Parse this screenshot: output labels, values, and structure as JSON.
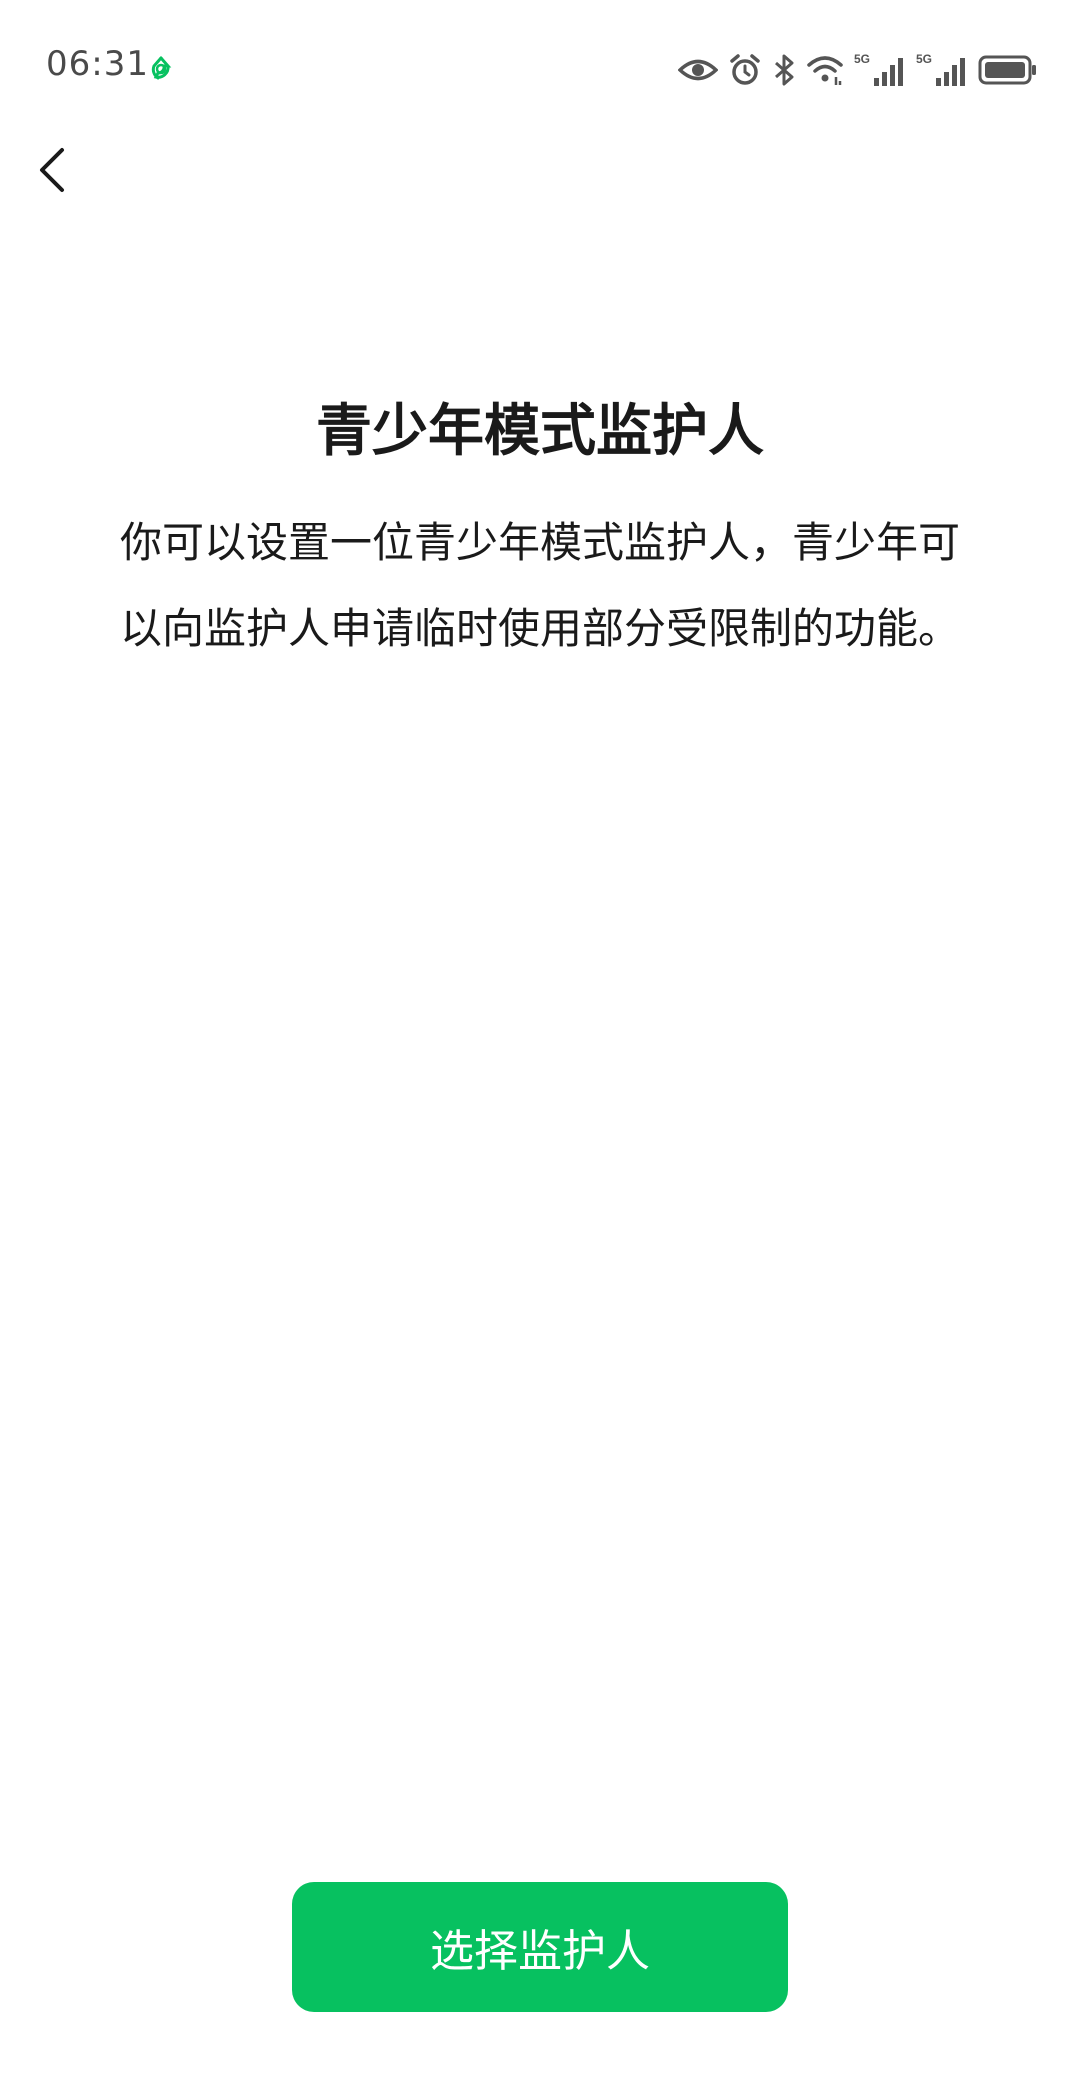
{
  "status_bar": {
    "time": "06:31",
    "app_icon": "recycle-arrows-icon",
    "icons": [
      "eye-icon",
      "alarm-icon",
      "bluetooth-icon",
      "wifi-icon",
      "signal-5g-icon",
      "signal-5g-icon",
      "battery-icon"
    ],
    "network_label_1": "5G",
    "network_label_2": "5G",
    "accent_color": "#07c160"
  },
  "navigation": {
    "back_icon": "chevron-left-icon"
  },
  "main": {
    "title": "青少年模式监护人",
    "description": "你可以设置一位青少年模式监护人，青少年可以向监护人申请临时使用部分受限制的功能。"
  },
  "footer": {
    "primary_button_label": "选择监护人",
    "primary_button_color": "#07c160"
  }
}
